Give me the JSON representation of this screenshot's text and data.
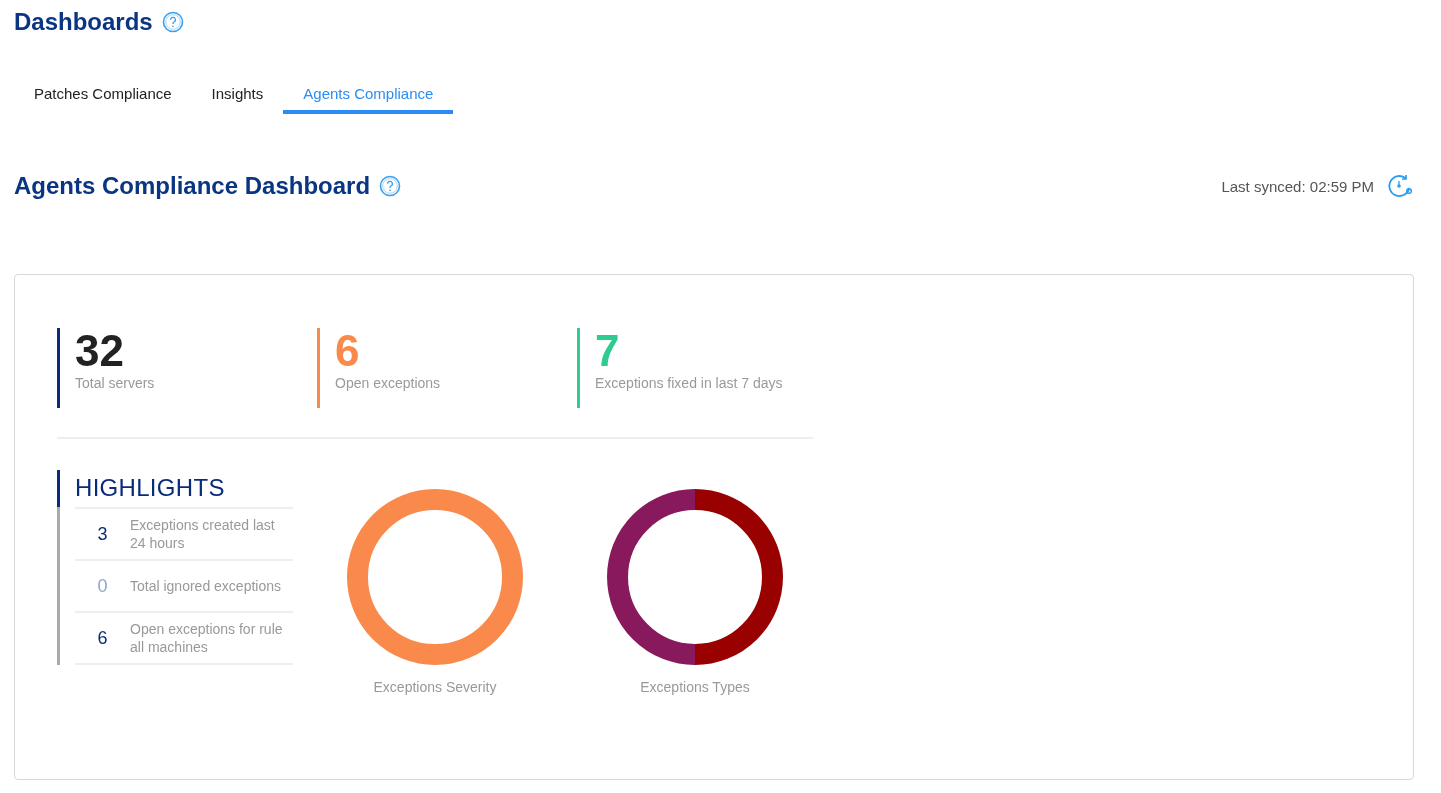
{
  "page": {
    "title": "Dashboards"
  },
  "tabs": [
    {
      "label": "Patches Compliance",
      "selected": false
    },
    {
      "label": "Insights",
      "selected": false
    },
    {
      "label": "Agents Compliance",
      "selected": true
    }
  ],
  "dashboard": {
    "title": "Agents Compliance Dashboard",
    "last_synced": "Last synced: 02:59 PM"
  },
  "stats": [
    {
      "value": "32",
      "label": "Total servers",
      "color": "#0a2a7a"
    },
    {
      "value": "6",
      "label": "Open exceptions",
      "color": "#f98a4b"
    },
    {
      "value": "7",
      "label": "Exceptions fixed in last 7 days",
      "color": "#2ecc8f"
    }
  ],
  "highlights": {
    "title": "HIGHLIGHTS",
    "items": [
      {
        "count": "3",
        "label": "Exceptions created last 24 hours",
        "dimmed": false
      },
      {
        "count": "0",
        "label": "Total ignored exceptions",
        "dimmed": true
      },
      {
        "count": "6",
        "label": "Open exceptions for rule all machines",
        "dimmed": false
      }
    ]
  },
  "charts": [
    {
      "kind": "single",
      "caption": "Exceptions Severity"
    },
    {
      "kind": "split",
      "caption": "Exceptions Types"
    }
  ]
}
